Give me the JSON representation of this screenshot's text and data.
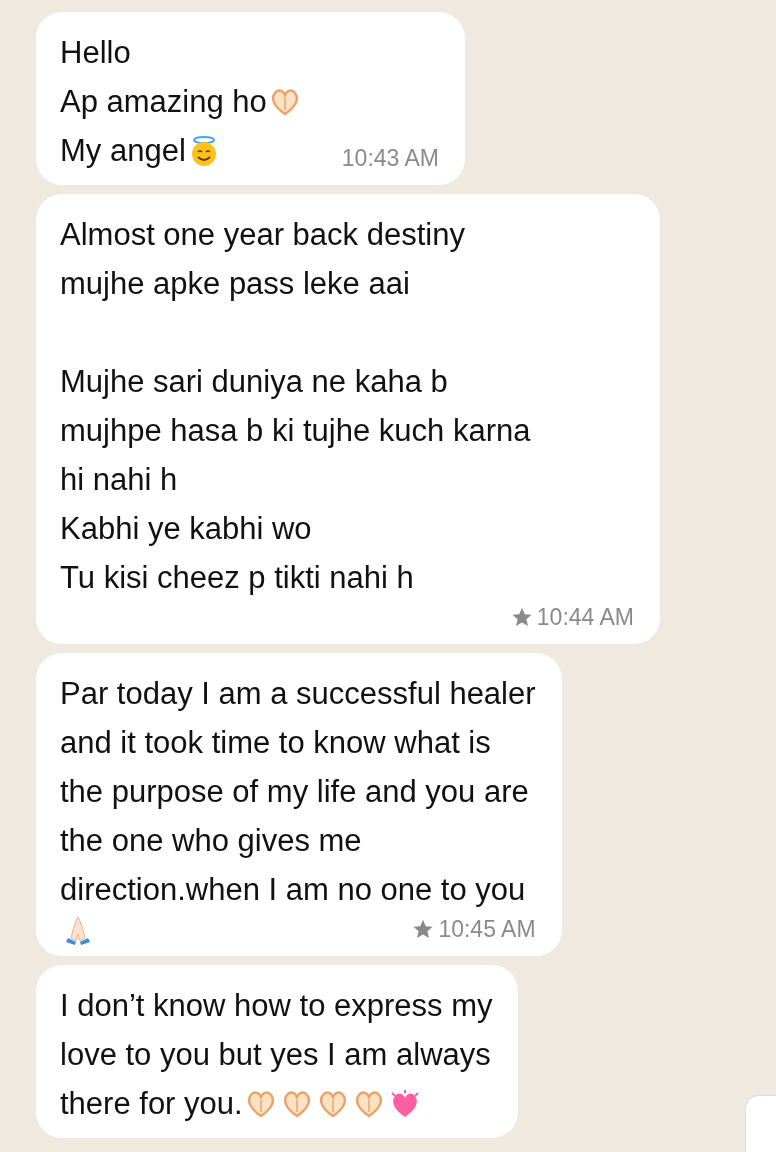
{
  "messages": [
    {
      "paragraphs": [
        [
          {
            "text": "Hello"
          },
          {
            "text": "Ap amazing ho",
            "emojis": [
              {
                "kind": "heart_hands"
              }
            ]
          },
          {
            "text": "My  angel",
            "emojis": [
              {
                "kind": "angel"
              }
            ]
          }
        ]
      ],
      "starred": false,
      "time": "10:43 AM"
    },
    {
      "paragraphs": [
        [
          {
            "text": "Almost one year back destiny"
          },
          {
            "text": "mujhe apke pass leke aai"
          }
        ],
        [
          {
            "text": "Mujhe sari duniya ne kaha b"
          },
          {
            "text": "mujhpe hasa b ki tujhe kuch karna"
          },
          {
            "text": "hi nahi h"
          },
          {
            "text": "Kabhi ye kabhi wo"
          },
          {
            "text": "Tu kisi cheez p tikti nahi h"
          }
        ]
      ],
      "starred": true,
      "time": "10:44 AM"
    },
    {
      "paragraphs": [
        [
          {
            "text": "Par today I am a successful healer"
          },
          {
            "text": "and it took time to know what is"
          },
          {
            "text": "the purpose of my life and you are"
          },
          {
            "text": "the one who gives me"
          },
          {
            "text": "direction.when I am no one to you"
          },
          {
            "emojis": [
              {
                "kind": "praying"
              }
            ]
          }
        ]
      ],
      "starred": true,
      "time": "10:45 AM"
    },
    {
      "paragraphs": [
        [
          {
            "text": "I don’t know how to express my"
          },
          {
            "text": "love to you but yes I am always"
          },
          {
            "text": "there for you.",
            "emojis": [
              {
                "kind": "heart_hands"
              },
              {
                "kind": "heart_hands"
              },
              {
                "kind": "heart_hands"
              },
              {
                "kind": "heart_hands"
              },
              {
                "kind": "beating_heart"
              }
            ]
          }
        ]
      ]
    }
  ]
}
